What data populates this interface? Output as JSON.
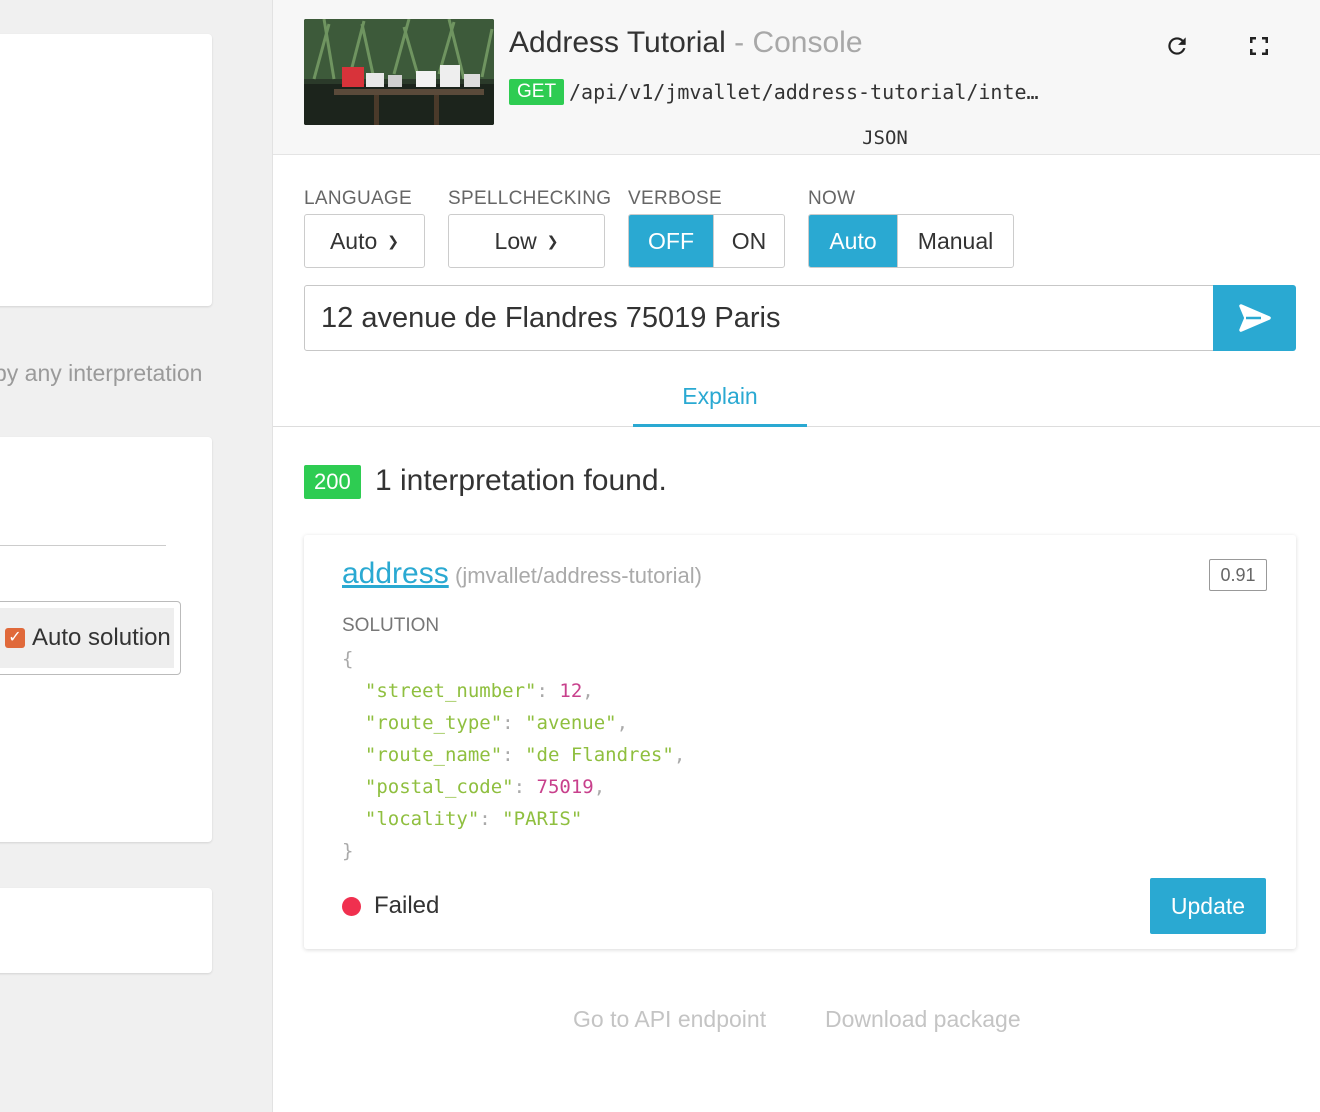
{
  "left_panel": {
    "hint_text": "by any interpretation",
    "auto_solution_label": "Auto solution"
  },
  "header": {
    "title": "Address Tutorial",
    "separator": " - ",
    "subtitle": "Console",
    "method": "GET",
    "endpoint": "/api/v1/jmvallet/address-tutorial/inte…"
  },
  "controls": {
    "language": {
      "label": "LANGUAGE",
      "value": "Auto"
    },
    "spellchecking": {
      "label": "SPELLCHECKING",
      "value": "Low"
    },
    "verbose": {
      "label": "VERBOSE",
      "options": [
        "OFF",
        "ON"
      ],
      "selected": "OFF"
    },
    "now": {
      "label": "NOW",
      "options": [
        "Auto",
        "Manual"
      ],
      "selected": "Auto"
    }
  },
  "query": {
    "value": "12 avenue de Flandres 75019 Paris"
  },
  "tabs": [
    {
      "label": "Explain",
      "active": true
    },
    {
      "label": "JSON",
      "active": false
    }
  ],
  "result": {
    "status_code": "200",
    "summary": "1 interpretation found.",
    "intent": "address",
    "intent_source": "(jmvallet/address-tutorial)",
    "score": "0.91",
    "solution_label": "SOLUTION",
    "solution": {
      "street_number": 12,
      "route_type": "avenue",
      "route_name": "de Flandres",
      "postal_code": 75019,
      "locality": "PARIS"
    },
    "status": "Failed",
    "update_label": "Update"
  },
  "footer": {
    "api_link": "Go to API endpoint",
    "download_link": "Download package"
  },
  "colors": {
    "accent": "#2aa9d2",
    "success": "#2ecc52",
    "failed": "#f0304f"
  }
}
